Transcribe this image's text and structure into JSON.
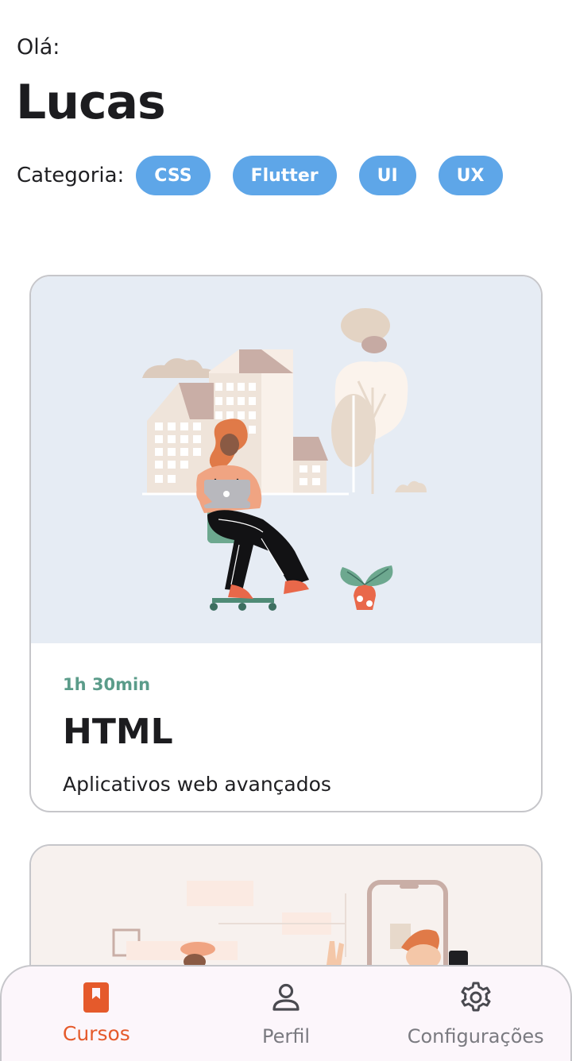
{
  "header": {
    "greeting": "Olá:",
    "username": "Lucas"
  },
  "categories": {
    "label": "Categoria:",
    "items": [
      "CSS",
      "Flutter",
      "UI",
      "UX"
    ]
  },
  "courses": [
    {
      "duration": "1h 30min",
      "title": "HTML",
      "subtitle": "Aplicativos web avançados",
      "illustration": "woman-with-laptop-city"
    },
    {
      "illustration": "people-with-phone"
    }
  ],
  "nav": {
    "items": [
      {
        "label": "Cursos",
        "icon": "bookmark-book-icon",
        "active": true
      },
      {
        "label": "Perfil",
        "icon": "person-icon",
        "active": false
      },
      {
        "label": "Configurações",
        "icon": "gear-icon",
        "active": false
      }
    ]
  },
  "colors": {
    "accent": "#5ea6e8",
    "active": "#e55a2b",
    "duration": "#5b9c8a"
  }
}
